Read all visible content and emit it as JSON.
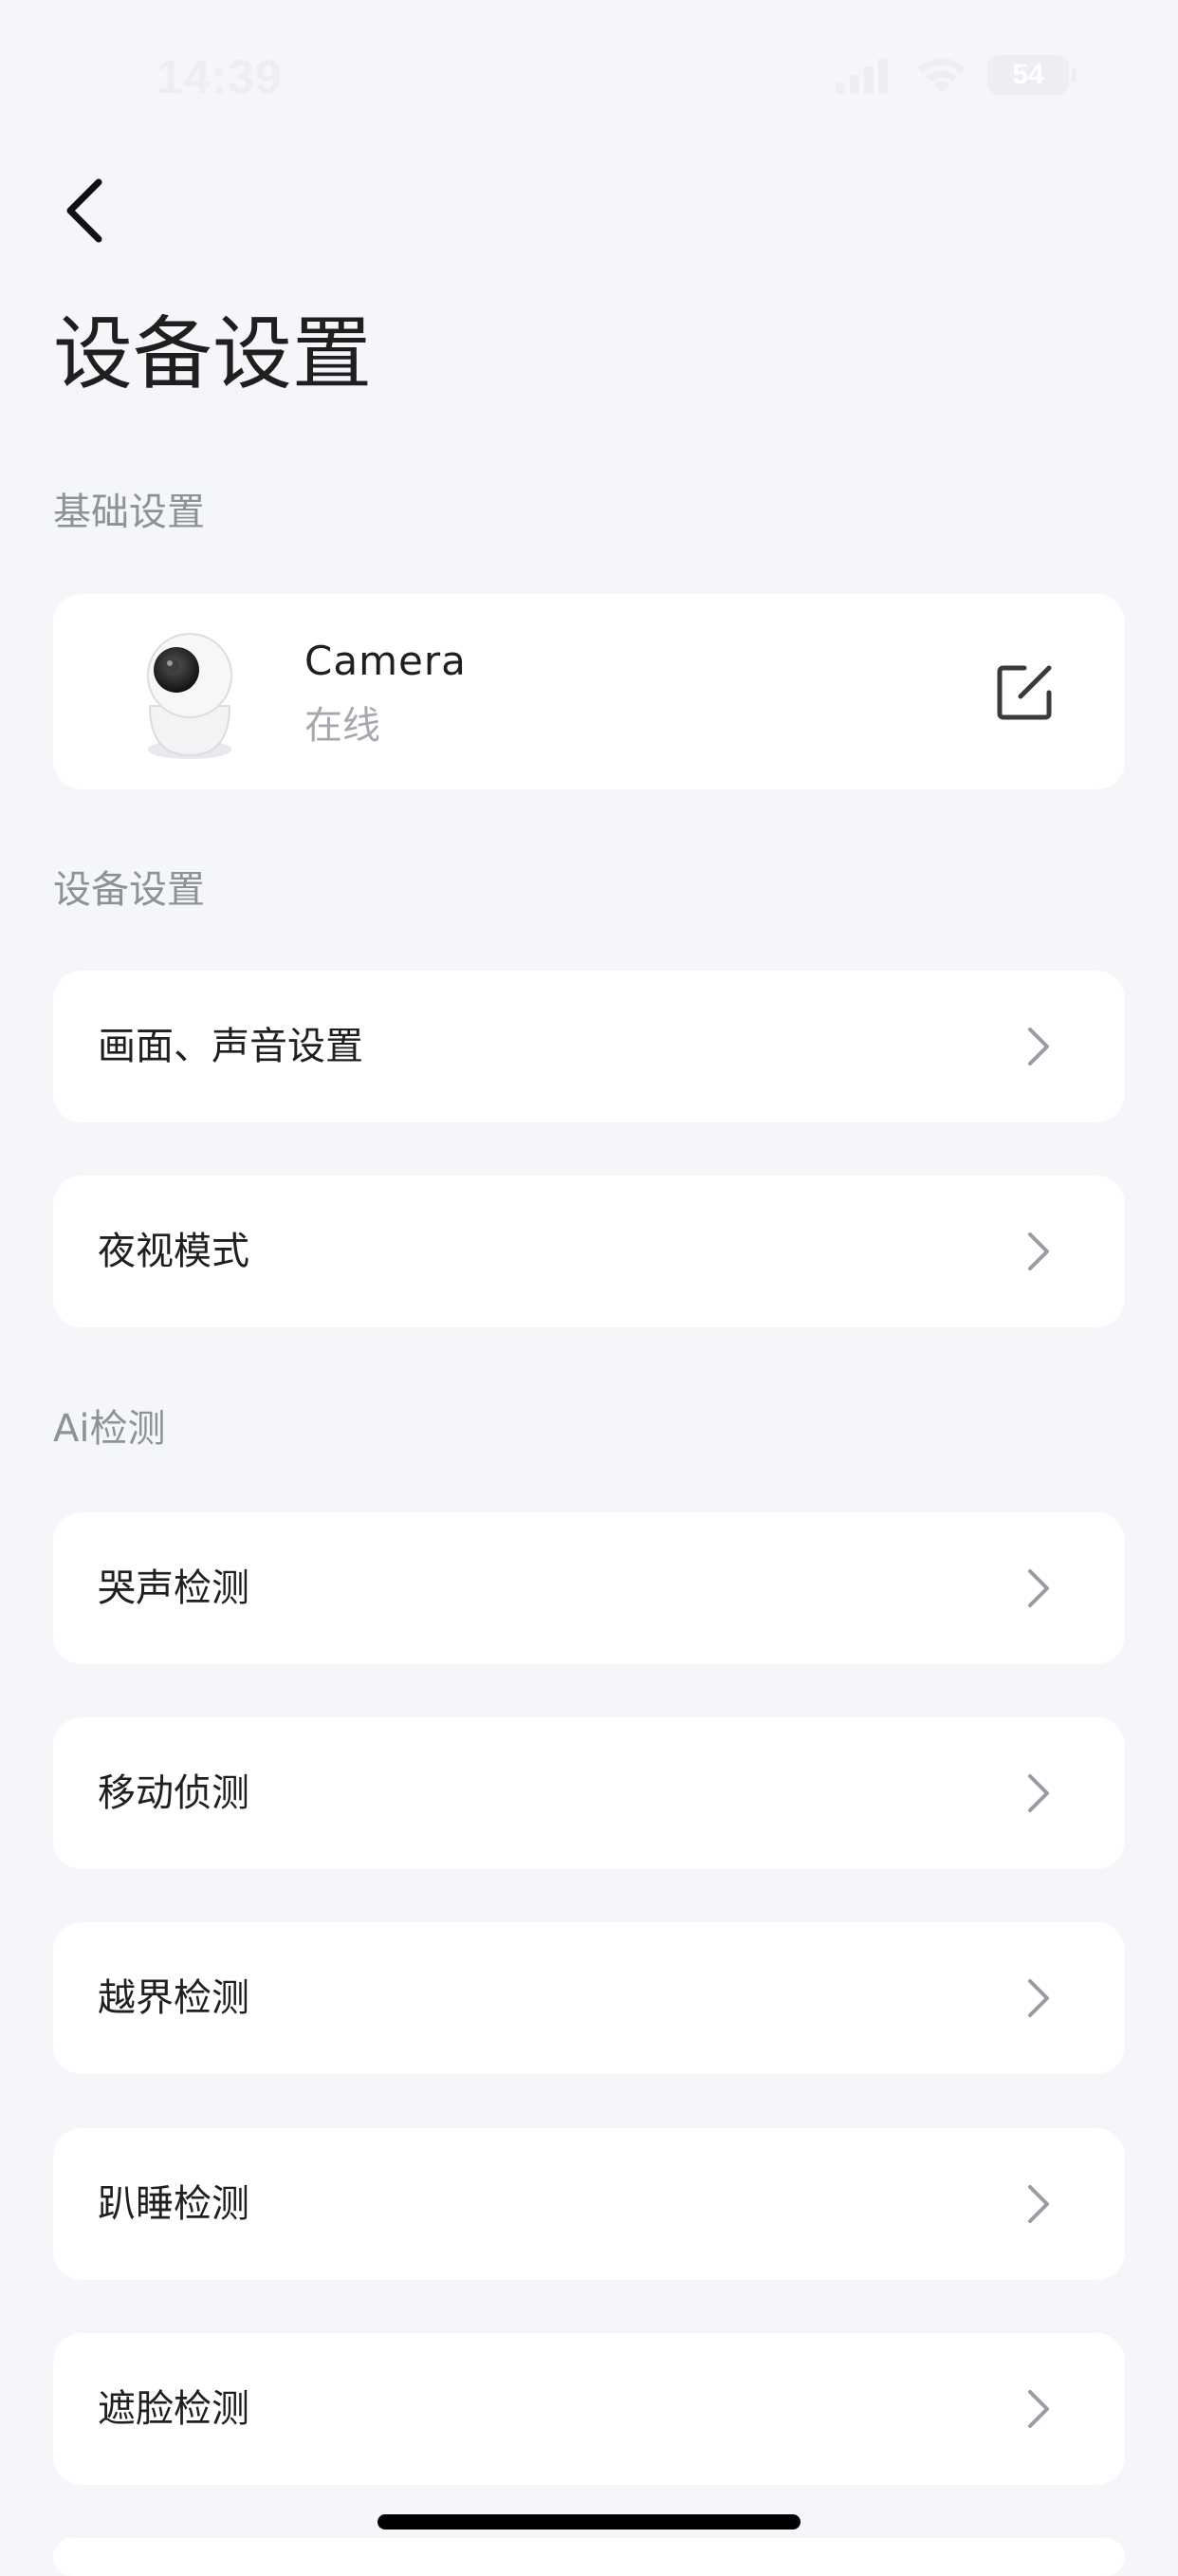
{
  "status_bar": {
    "time": "14:39",
    "battery": "54"
  },
  "header": {
    "title": "设备设置"
  },
  "sections": {
    "basic": "基础设置",
    "device": "设备设置",
    "ai": "Ai检测"
  },
  "device": {
    "name": "Camera",
    "status": "在线"
  },
  "menu": {
    "items": [
      {
        "label": "画面、声音设置"
      },
      {
        "label": "夜视模式"
      },
      {
        "label": "哭声检测"
      },
      {
        "label": "移动侦测"
      },
      {
        "label": "越界检测"
      },
      {
        "label": "趴睡检测"
      },
      {
        "label": "遮脸检测"
      }
    ]
  },
  "colors": {
    "background": "#f5f6fa",
    "card": "#ffffff",
    "primary_text": "#1f1f1f",
    "secondary_text": "#8f9199",
    "chevron": "#9a9ca3"
  }
}
